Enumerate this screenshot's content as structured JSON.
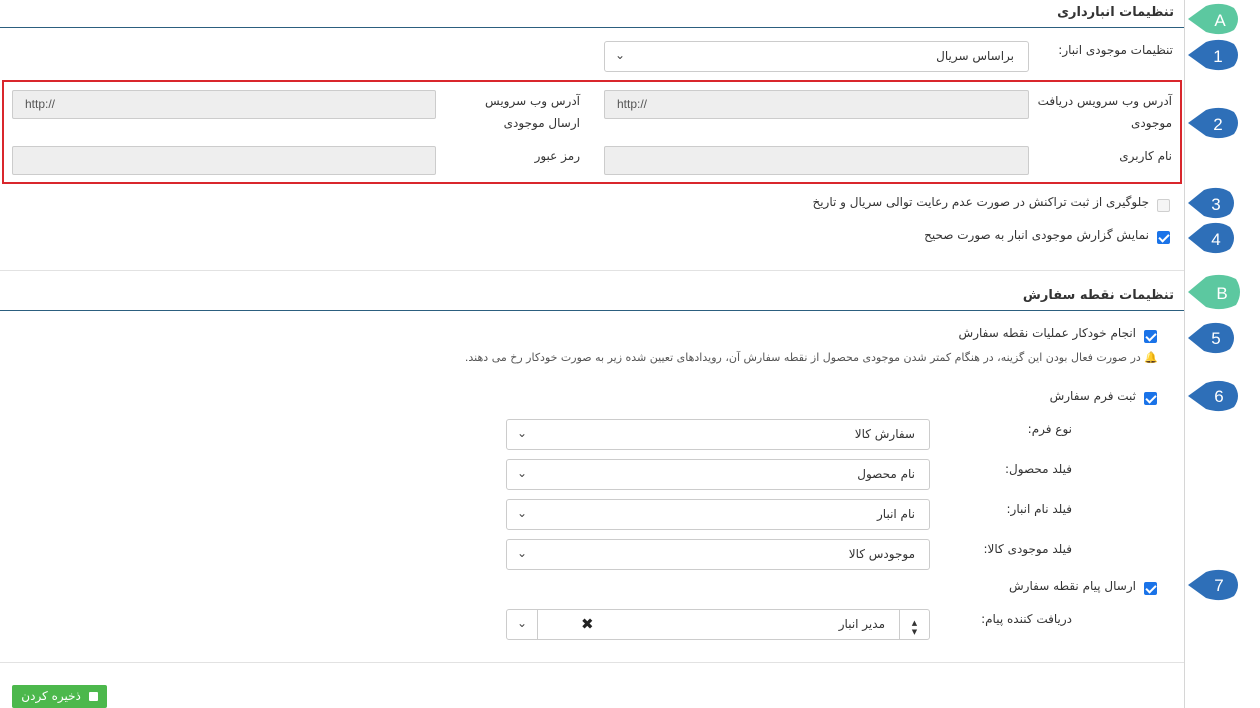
{
  "inventory": {
    "title": "تنظیمات انبارداری",
    "stock_setting_label": "تنظیمات موجودی انبار:",
    "stock_setting_value": "براساس سریال",
    "receive_ws_label": "آدرس وب سرویس دریافت موجودی",
    "receive_ws_value": "http://",
    "send_ws_label": "آدرس وب سرویس ارسال موجودی",
    "send_ws_value": "http://",
    "username_label": "نام کاربری",
    "username_value": "",
    "password_label": "رمز عبور",
    "password_value": "",
    "prevent_label": "جلوگیری از ثبت تراکنش در صورت عدم رعایت توالی سریال و تاریخ",
    "prevent_checked": false,
    "show_report_label": "نمایش گزارش موجودی انبار به صورت صحیح",
    "show_report_checked": true
  },
  "order_point": {
    "title": "تنظیمات نقطه سفارش",
    "auto_label": "انجام خودکار عملیات نقطه سفارش",
    "auto_checked": true,
    "hint": "در صورت فعال بودن این گزینه، در هنگام کمتر شدن موجودی محصول از نقطه سفارش آن، رویدادهای تعیین شده زیر به صورت خودکار رخ می دهند.",
    "register_form_label": "ثبت فرم سفارش",
    "register_form_checked": true,
    "form_type_label": "نوع فرم:",
    "form_type_value": "سفارش کالا",
    "product_field_label": "فیلد محصول:",
    "product_field_value": "نام محصول",
    "warehouse_field_label": "فیلد نام انبار:",
    "warehouse_field_value": "نام انبار",
    "stock_field_label": "فیلد موجودی کالا:",
    "stock_field_value": "موجودس کالا",
    "send_msg_label": "ارسال پیام نقطه سفارش",
    "send_msg_checked": true,
    "receiver_label": "دریافت کننده پیام:",
    "receiver_value": "مدیر انبار"
  },
  "save_button": "ذخیره کردن",
  "markers": [
    "A",
    "1",
    "2",
    "3",
    "4",
    "B",
    "5",
    "6",
    "7"
  ],
  "colors": {
    "marker_blue": "#2e6fb8",
    "marker_green": "#5cc8a0",
    "highlight_red": "#d9262c",
    "checkbox_blue": "#1a73e8",
    "save_green": "#4cb84c",
    "header_rule": "#2c5f7f"
  }
}
